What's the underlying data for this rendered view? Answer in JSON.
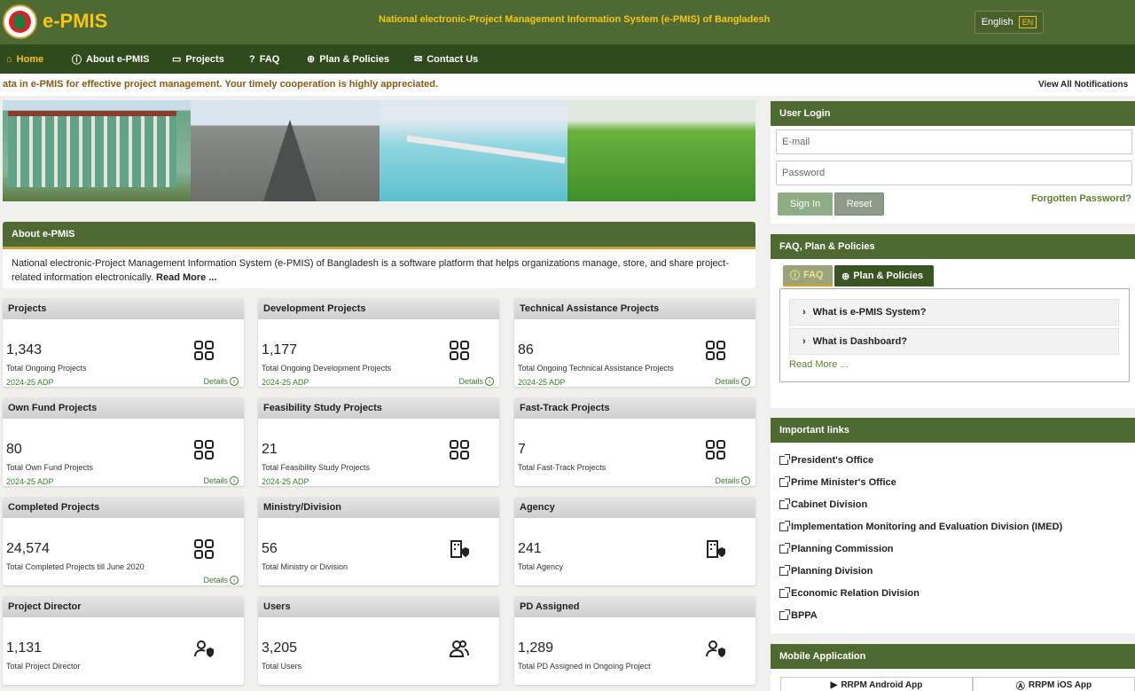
{
  "header": {
    "brand": "e-PMIS",
    "site_title": "National electronic-Project Management Information System (e-PMIS) of Bangladesh",
    "language_label": "English",
    "language_code": "EN"
  },
  "nav": {
    "items": [
      {
        "label": "Home",
        "icon": "home-icon"
      },
      {
        "label": "About e-PMIS",
        "icon": "info-icon"
      },
      {
        "label": "Projects",
        "icon": "folder-icon"
      },
      {
        "label": "FAQ",
        "icon": "question-icon"
      },
      {
        "label": "Plan & Policies",
        "icon": "globe-icon"
      },
      {
        "label": "Contact Us",
        "icon": "envelope-icon"
      }
    ]
  },
  "ticker": {
    "text": "ata in e-PMIS for effective project management. Your timely cooperation is highly appreciated.",
    "view_all": "View All Notifications"
  },
  "about": {
    "title": "About e-PMIS",
    "text": "National electronic-Project Management Information System (e-PMIS) of Bangladesh is a software platform that helps organizations manage, store, and share project-related information electronically.",
    "read_more": "Read More ..."
  },
  "stats": [
    {
      "title": "Projects",
      "value": "1,343",
      "label": "Total Ongoing Projects",
      "adp": "2024-25 ADP",
      "details": "Details",
      "icon": "grid-icon"
    },
    {
      "title": "Development Projects",
      "value": "1,177",
      "label": "Total Ongoing Development Projects",
      "adp": "2024-25 ADP",
      "details": "Details",
      "icon": "grid-icon"
    },
    {
      "title": "Technical Assistance Projects",
      "value": "86",
      "label": "Total Ongoing Technical Assistance Projects",
      "adp": "2024-25 ADP",
      "details": "Details",
      "icon": "grid-icon"
    },
    {
      "title": "Own Fund Projects",
      "value": "80",
      "label": "Total Own Fund Projects",
      "adp": "2024-25 ADP",
      "details": "Details",
      "icon": "grid-icon"
    },
    {
      "title": "Feasibility Study Projects",
      "value": "21",
      "label": "Total Feasibility Study Projects",
      "adp": "2024-25 ADP",
      "details": "",
      "icon": "grid-icon"
    },
    {
      "title": "Fast-Track Projects",
      "value": "7",
      "label": "Total Fast-Track Projects",
      "adp": "",
      "details": "Details",
      "icon": "grid-icon"
    },
    {
      "title": "Completed Projects",
      "value": "24,574",
      "label": "Total Completed Projects till June 2020",
      "adp": "",
      "details": "Details",
      "icon": "grid-icon"
    },
    {
      "title": "Ministry/Division",
      "value": "56",
      "label": "Total Ministry or Division",
      "adp": "",
      "details": "",
      "icon": "building-shield-icon"
    },
    {
      "title": "Agency",
      "value": "241",
      "label": "Total Agency",
      "adp": "",
      "details": "",
      "icon": "building-shield-icon"
    },
    {
      "title": "Project Director",
      "value": "1,131",
      "label": "Total Project Director",
      "adp": "",
      "details": "",
      "icon": "user-shield-icon"
    },
    {
      "title": "Users",
      "value": "3,205",
      "label": "Total Users",
      "adp": "",
      "details": "",
      "icon": "users-icon"
    },
    {
      "title": "PD Assigned",
      "value": "1,289",
      "label": "Total PD Assigned in Ongoing Project",
      "adp": "",
      "details": "",
      "icon": "user-shield-icon"
    }
  ],
  "login": {
    "title": "User Login",
    "email_placeholder": "E-mail",
    "password_placeholder": "Password",
    "sign_in": "Sign In",
    "reset": "Reset",
    "forgot": "Forgotten Password?"
  },
  "faq": {
    "title": "FAQ, Plan & Policies",
    "tab_faq": "FAQ",
    "tab_plan": "Plan & Policies",
    "questions": [
      "What is e-PMIS System?",
      "What is Dashboard?"
    ],
    "read_more": "Read More ..."
  },
  "links": {
    "title": "Important links",
    "items": [
      "President's Office",
      "Prime Minister's Office",
      "Cabinet Division",
      "Implementation Monitoring and Evaluation Division (IMED)",
      "Planning Commission",
      "Planning Division",
      "Economic Relation Division",
      "BPPA"
    ]
  },
  "mobile": {
    "title": "Mobile Application",
    "android": "RRPM Android App",
    "ios": "RRPM iOS App"
  },
  "colors": {
    "header_green": "#4e6a32",
    "nav_green": "#2f4a1c",
    "accent_gold": "#f5c518"
  }
}
